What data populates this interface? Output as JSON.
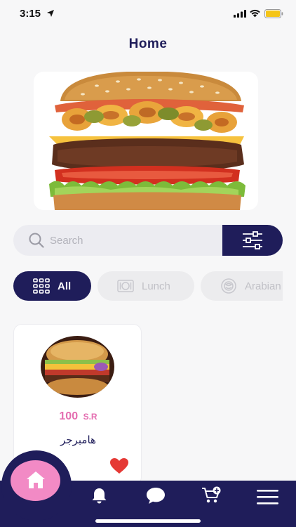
{
  "status_bar": {
    "time": "3:15"
  },
  "header": {
    "title": "Home"
  },
  "search": {
    "placeholder": "Search"
  },
  "categories": [
    {
      "label": "All",
      "icon": "grid-icon",
      "selected": true
    },
    {
      "label": "Lunch",
      "icon": "lunch-icon",
      "selected": false
    },
    {
      "label": "Arabian",
      "icon": "arabian-icon",
      "selected": false
    }
  ],
  "products": [
    {
      "price": "100",
      "currency": "S.R",
      "name": "هامبرجر",
      "favorite": true
    }
  ],
  "bottom_nav": {
    "items": [
      "home-icon",
      "bell-icon",
      "chat-icon",
      "cart-icon",
      "menu-icon"
    ]
  },
  "colors": {
    "primary": "#1f1d5a",
    "accent": "#f28ac5",
    "price": "#e46db0",
    "favorite": "#e53935"
  }
}
